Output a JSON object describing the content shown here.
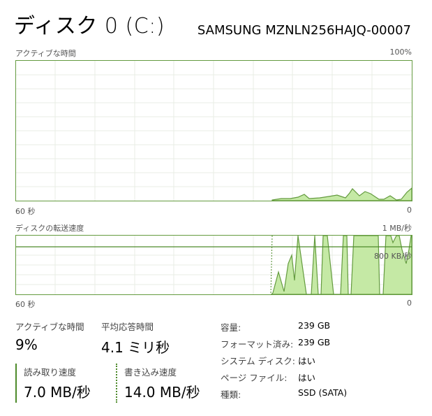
{
  "header": {
    "title": "ディスク 0 (C:)",
    "model": "SAMSUNG MZNLN256HAJQ-00007"
  },
  "active_time_chart": {
    "label": "アクティブな時間",
    "max_label": "100%",
    "time_left": "60 秒",
    "time_right": "0"
  },
  "transfer_chart": {
    "label": "ディスクの転送速度",
    "max_label": "1 MB/秒",
    "ref_label": "800 KB/秒",
    "time_left": "60 秒",
    "time_right": "0"
  },
  "stats": {
    "active_time": {
      "label": "アクティブな時間",
      "value": "9%"
    },
    "avg_response": {
      "label": "平均応答時間",
      "value": "4.1 ミリ秒"
    },
    "read_speed": {
      "label": "読み取り速度",
      "value": "7.0 MB/秒"
    },
    "write_speed": {
      "label": "書き込み速度",
      "value": "14.0 MB/秒"
    }
  },
  "info": [
    {
      "key": "容量:",
      "value": "239 GB"
    },
    {
      "key": "フォーマット済み:",
      "value": "239 GB"
    },
    {
      "key": "システム ディスク:",
      "value": "はい"
    },
    {
      "key": "ページ ファイル:",
      "value": "はい"
    },
    {
      "key": "種類:",
      "value": "SSD (SATA)"
    }
  ],
  "colors": {
    "accent": "#649b3f",
    "fill": "#c5e9a5",
    "grid": "#e8eee4"
  }
}
